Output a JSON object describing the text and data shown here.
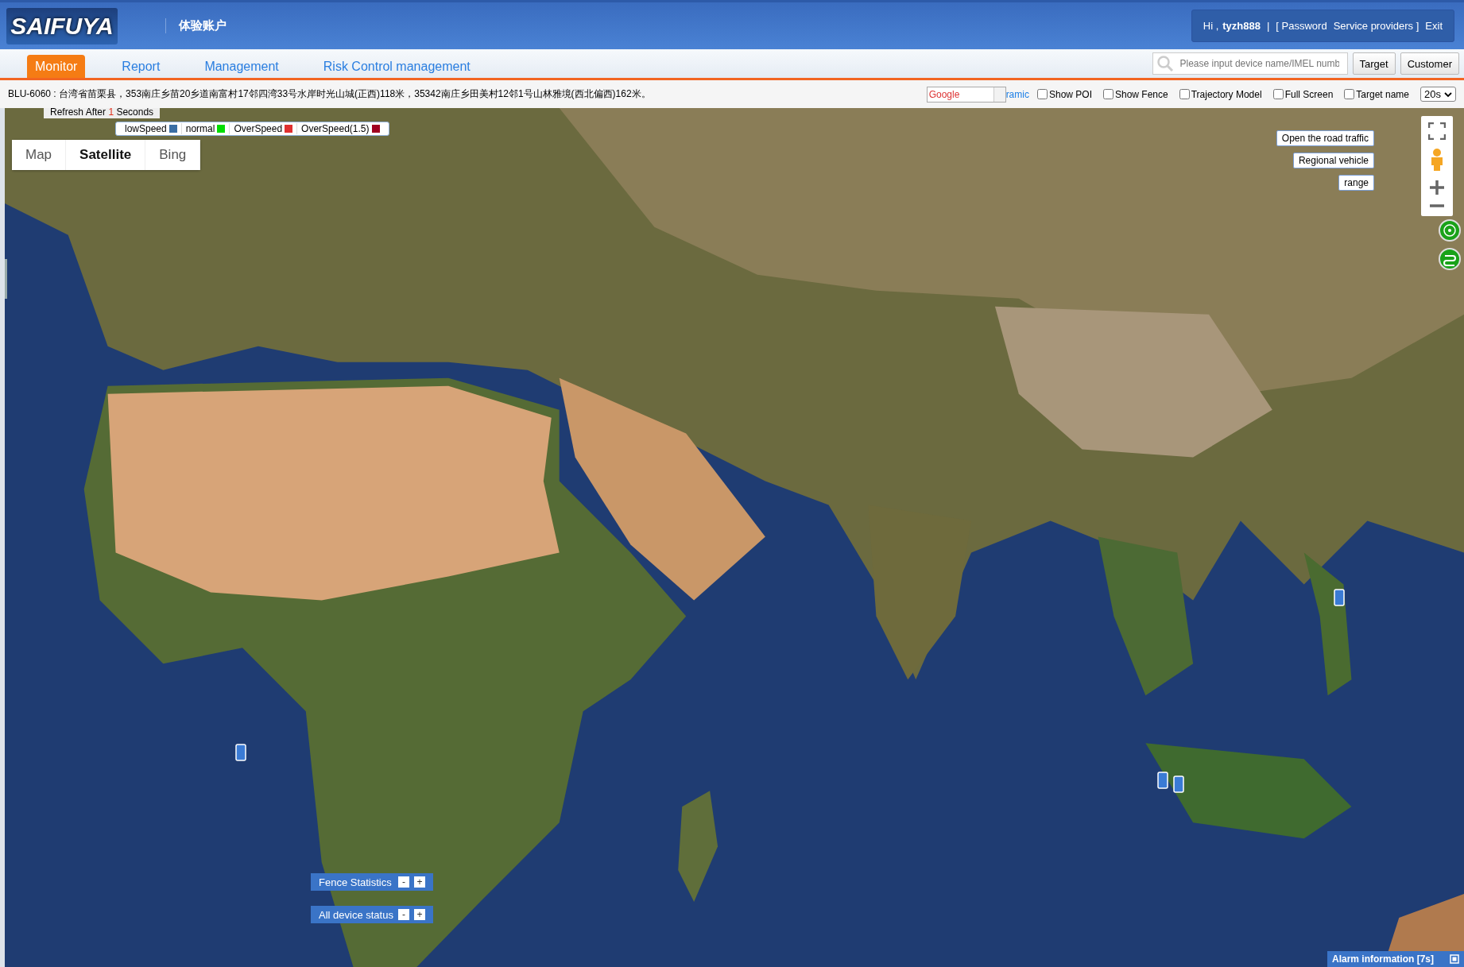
{
  "header": {
    "logo": "SAIFUYA",
    "account": "体验账户",
    "greeting": "Hi ,",
    "username": "tyzh888",
    "separator": "|",
    "links": [
      "[ Password",
      "Service providers ]",
      "Exit"
    ]
  },
  "nav": {
    "tabs": [
      {
        "label": "Monitor",
        "selected": true
      },
      {
        "label": "Report",
        "selected": false
      },
      {
        "label": "Management",
        "selected": false
      },
      {
        "label": "Risk Control management",
        "selected": false
      }
    ],
    "search": {
      "placeholder": "Please input device name/IMEL numb"
    },
    "buttons": [
      "Target",
      "Customer"
    ]
  },
  "address": "BLU-6060 : 台湾省苗栗县，353南庄乡苗20乡道南富村17邻四湾33号水岸时光山城(正西)118米，35342南庄乡田美村12邻1号山林雅境(西北偏西)162米。",
  "map_toolbar": {
    "source": "Google",
    "link": "ramic",
    "options": [
      {
        "label": "Show POI",
        "checked": false
      },
      {
        "label": "Show Fence",
        "checked": false
      },
      {
        "label": "Trajectory Model",
        "checked": false
      },
      {
        "label": "Full Screen",
        "checked": false
      },
      {
        "label": "Target name",
        "checked": false
      }
    ],
    "interval": "20s"
  },
  "map": {
    "kind": "picture",
    "refresh": {
      "prefix": "Refresh After",
      "count": "1",
      "suffix": "Seconds"
    },
    "legend": [
      {
        "label": "lowSpeed",
        "color": "#3a6ea5"
      },
      {
        "label": "normal",
        "color": "#00dd00"
      },
      {
        "label": "OverSpeed",
        "color": "#e03030"
      },
      {
        "label": "OverSpeed(1.5)",
        "color": "#a00020"
      }
    ],
    "map_types": [
      {
        "label": "Map",
        "selected": false
      },
      {
        "label": "Satellite",
        "selected": true
      },
      {
        "label": "Bing",
        "selected": false
      }
    ],
    "side_buttons": [
      "Open the road traffic",
      "Regional vehicle",
      "range"
    ],
    "panels": [
      {
        "title": "Fence Statistics",
        "collapse": "-",
        "expand": "+"
      },
      {
        "title": "All device status",
        "collapse": "-",
        "expand": "+"
      }
    ],
    "alarm": "Alarm information [7s]"
  }
}
